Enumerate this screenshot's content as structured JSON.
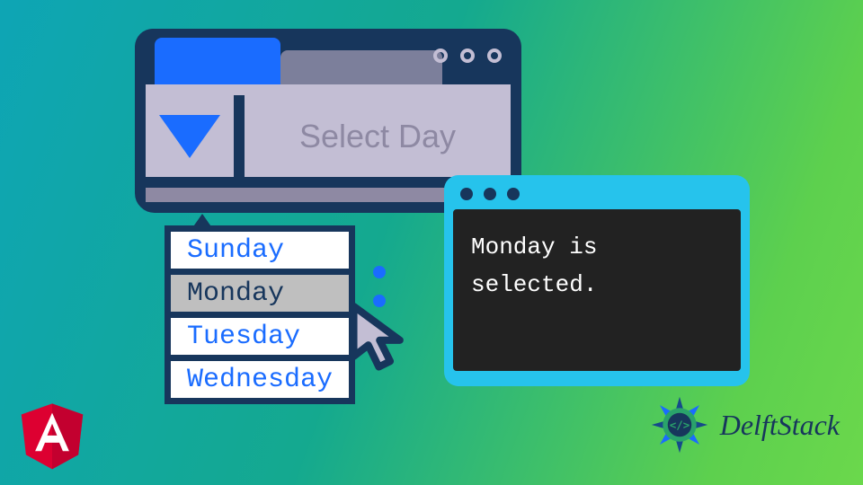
{
  "select": {
    "placeholder": "Select Day",
    "options": [
      "Sunday",
      "Monday",
      "Tuesday",
      "Wednesday"
    ],
    "selected_index": 1
  },
  "terminal": {
    "output": "Monday is selected."
  },
  "brand": {
    "name": "DelftStack"
  },
  "colors": {
    "accent": "#1a6cff",
    "frame": "#17365c",
    "terminal_bg": "#26c3ec",
    "angular": "#dd0031"
  }
}
